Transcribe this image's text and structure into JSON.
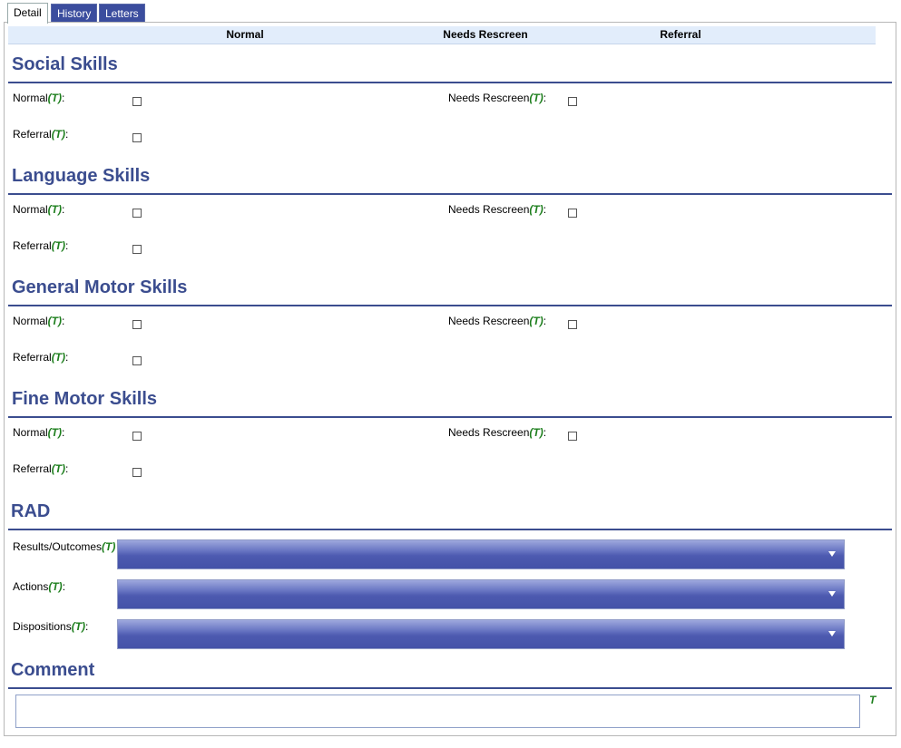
{
  "tabs": [
    {
      "label": "Detail",
      "active": true
    },
    {
      "label": "History",
      "active": false
    },
    {
      "label": "Letters",
      "active": false
    }
  ],
  "header": {
    "col1": "Normal",
    "col2": "Needs Rescreen",
    "col3": "Referral"
  },
  "t_marker": "(T)",
  "t_letter": "T",
  "sections": {
    "social": {
      "title": "Social Skills",
      "normal": "Normal",
      "needs_rescreen": "Needs Rescreen",
      "referral": "Referral",
      "colon": ":"
    },
    "language": {
      "title": "Language Skills",
      "normal": "Normal",
      "needs_rescreen": "Needs Rescreen",
      "referral": "Referral",
      "colon": ":"
    },
    "general_motor": {
      "title": "General Motor Skills",
      "normal": "Normal",
      "needs_rescreen": "Needs Rescreen",
      "referral": "Referral",
      "colon": ":"
    },
    "fine_motor": {
      "title": "Fine Motor Skills",
      "normal": "Normal",
      "needs_rescreen": "Needs Rescreen",
      "referral": "Referral",
      "colon": ":"
    }
  },
  "rad": {
    "title": "RAD",
    "results_label": "Results/Outcomes",
    "actions_label": "Actions",
    "dispositions_label": "Dispositions",
    "colon": ":",
    "results_value": "",
    "actions_value": "",
    "dispositions_value": ""
  },
  "comment": {
    "title": "Comment",
    "value": ""
  },
  "colors": {
    "accent": "#3b4d8f",
    "tab_bg": "#3b4d9e",
    "t_green": "#1e7f1e",
    "header_bg": "#e2edfb"
  }
}
